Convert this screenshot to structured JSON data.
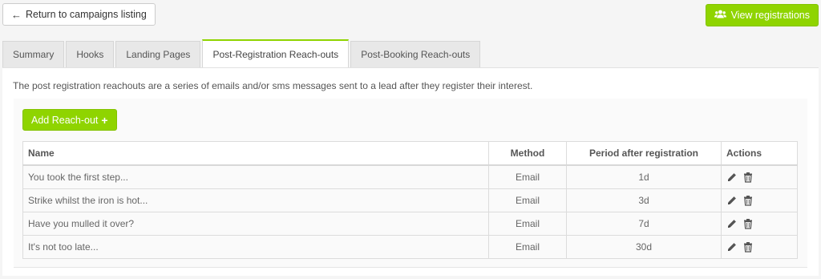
{
  "header": {
    "back_label": "Return to campaigns listing",
    "view_label": "View registrations"
  },
  "tabs": [
    {
      "label": "Summary"
    },
    {
      "label": "Hooks"
    },
    {
      "label": "Landing Pages"
    },
    {
      "label": "Post-Registration Reach-outs",
      "active": true
    },
    {
      "label": "Post-Booking Reach-outs"
    }
  ],
  "panel": {
    "intro": "The post registration reachouts are a series of emails and/or sms messages sent to a lead after they register their interest.",
    "add_label": "Add Reach-out"
  },
  "table": {
    "headers": {
      "name": "Name",
      "method": "Method",
      "period": "Period after registration",
      "actions": "Actions"
    },
    "rows": [
      {
        "name": "You took the first step...",
        "method": "Email",
        "period": "1d"
      },
      {
        "name": "Strike whilst the iron is hot...",
        "method": "Email",
        "period": "3d"
      },
      {
        "name": "Have you mulled it over?",
        "method": "Email",
        "period": "7d"
      },
      {
        "name": "It's not too late...",
        "method": "Email",
        "period": "30d"
      }
    ]
  },
  "icons": {
    "back": "arrow-left-icon",
    "view": "users-icon",
    "add": "plus-icon",
    "edit": "pencil-icon",
    "delete": "trash-icon"
  },
  "colors": {
    "accent": "#8fd400"
  }
}
